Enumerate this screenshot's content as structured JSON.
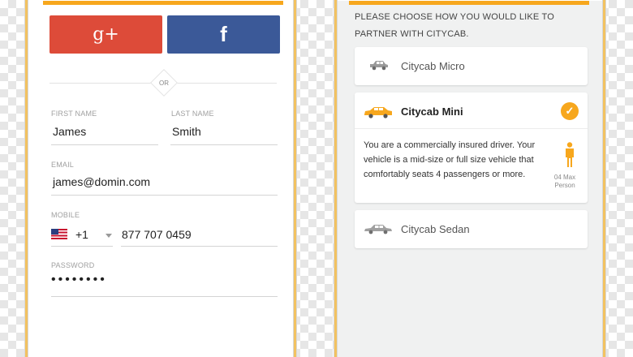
{
  "left_screen": {
    "google_label": "g+",
    "facebook_label": "f",
    "separator": "OR",
    "first_name": {
      "label": "FIRST NAME",
      "value": "James"
    },
    "last_name": {
      "label": "LAST NAME",
      "value": "Smith"
    },
    "email": {
      "label": "EMAIL",
      "value": "james@domin.com"
    },
    "mobile": {
      "label": "MOBILE",
      "country_code": "+1",
      "number": "877 707 0459"
    },
    "password": {
      "label": "PASSWORD",
      "value": "••••••••"
    }
  },
  "right_screen": {
    "prompt": "PLEASE CHOOSE HOW YOU WOULD LIKE TO PARTNER WITH CITYCAB.",
    "options": [
      {
        "name": "Citycab Micro",
        "selected": false
      },
      {
        "name": "Citycab Mini",
        "selected": true,
        "description": "You are a commercially insured driver. Your vehicle is a mid-size or full size vehicle that comfortably seats 4 passengers or more.",
        "capacity": "04 Max Person"
      },
      {
        "name": "Citycab Sedan",
        "selected": false
      }
    ]
  },
  "colors": {
    "accent": "#f7a71d",
    "google": "#dd4b39",
    "facebook": "#3b5998",
    "button_dark": "#3d4043"
  },
  "icons": [
    "flag-us-icon",
    "chevron-down-icon",
    "car-icon",
    "check-icon",
    "person-icon"
  ]
}
